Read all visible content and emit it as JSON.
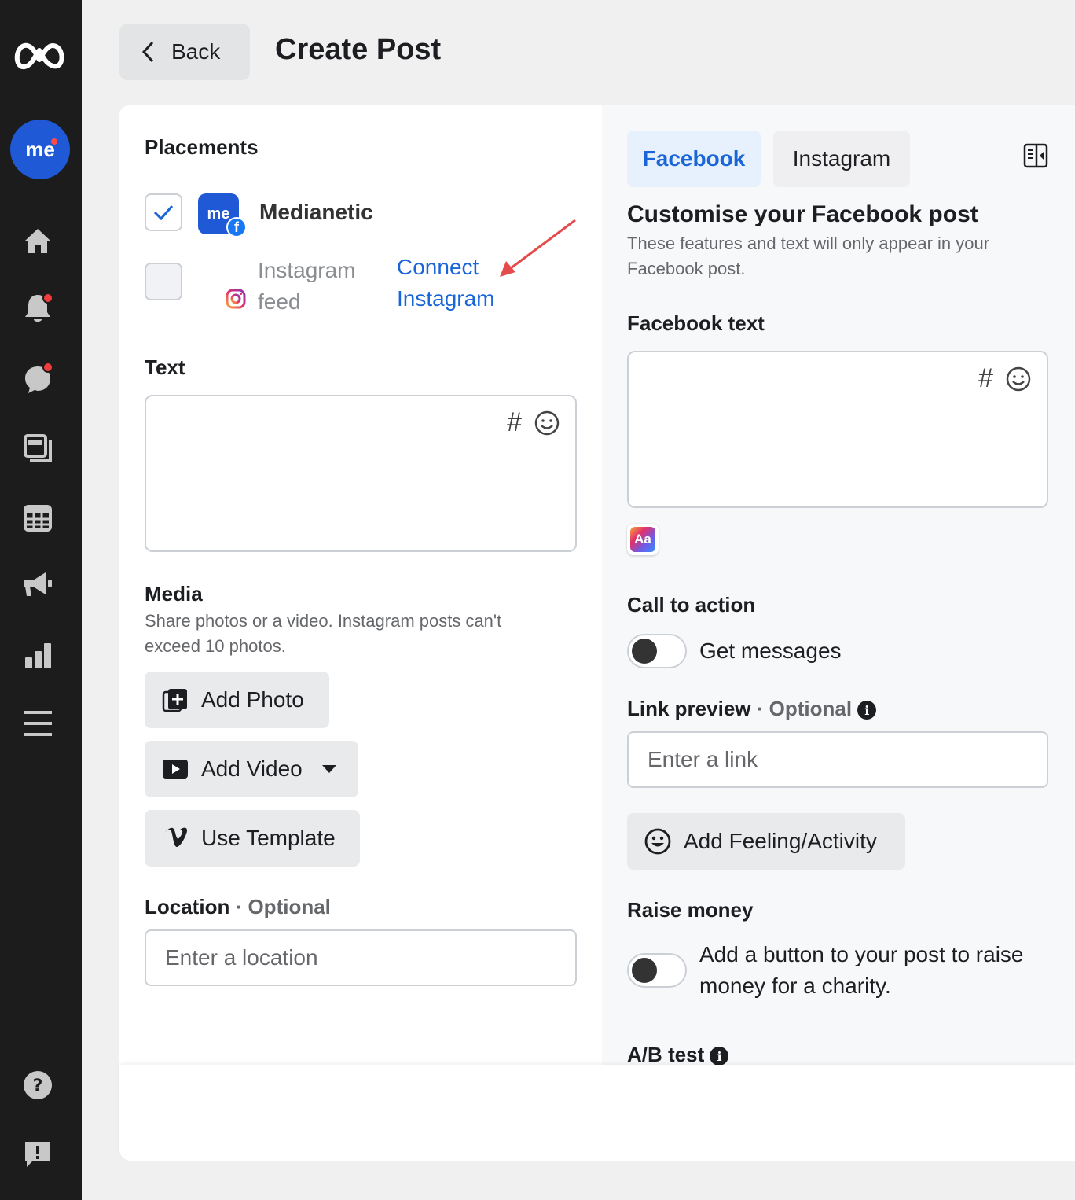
{
  "header": {
    "back_label": "Back",
    "title": "Create Post"
  },
  "sidebar": {
    "avatar_text": "me",
    "items": [
      "home-icon",
      "notifications-icon",
      "messages-icon",
      "content-icon",
      "calendar-icon",
      "ads-icon",
      "insights-icon",
      "menu-icon"
    ],
    "bottom": [
      "help-icon",
      "report-icon"
    ]
  },
  "placements": {
    "heading": "Placements",
    "page_name": "Medianetic",
    "page_avatar_text": "me",
    "instagram_label_line1": "Instagram",
    "instagram_label_line2": "feed",
    "connect_line1": "Connect",
    "connect_line2": "Instagram"
  },
  "text_section": {
    "heading": "Text",
    "hash": "#"
  },
  "media": {
    "heading": "Media",
    "description": "Share photos or a video. Instagram posts can't exceed 10 photos.",
    "add_photo": "Add Photo",
    "add_video": "Add Video",
    "use_template": "Use Template"
  },
  "location": {
    "heading": "Location",
    "optional": "· Optional",
    "placeholder": "Enter a location"
  },
  "preview_tabs": {
    "facebook": "Facebook",
    "instagram": "Instagram"
  },
  "customise": {
    "heading": "Customise your Facebook post",
    "description": "These features and text will only appear in your Facebook post."
  },
  "facebook_text": {
    "heading": "Facebook text",
    "hash": "#",
    "font_icon_text": "Aa"
  },
  "call_to_action": {
    "heading": "Call to action",
    "toggle_label": "Get messages",
    "enabled": false
  },
  "link_preview": {
    "heading": "Link preview",
    "optional": "· Optional",
    "placeholder": "Enter a link"
  },
  "feeling": {
    "label": "Add Feeling/Activity"
  },
  "raise_money": {
    "heading": "Raise money",
    "toggle_label": "Add a button to your post to raise money for a charity.",
    "enabled": false
  },
  "ab_test": {
    "heading": "A/B test"
  },
  "colors": {
    "accent": "#1a66d9",
    "rail": "#1c1c1d",
    "annotation_arrow": "#e54b4b"
  }
}
